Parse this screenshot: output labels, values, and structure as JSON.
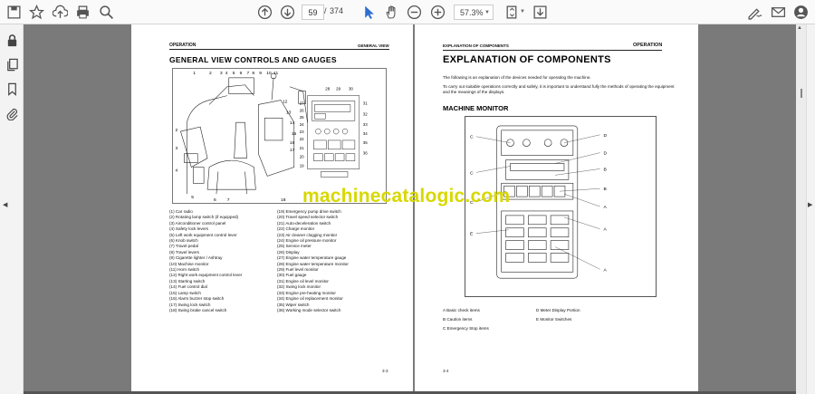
{
  "toolbar": {
    "page_current": "59",
    "page_separator": "/",
    "page_total": "374",
    "zoom_value": "57.3%",
    "icons": [
      "save-icon",
      "bookmark-star-icon",
      "upload-icon",
      "print-icon",
      "zoom-search-icon",
      "page-up-icon",
      "page-down-icon",
      "select-cursor-icon",
      "hand-icon",
      "zoom-out-icon",
      "zoom-in-icon",
      "fit-page-icon",
      "export-icon",
      "sign-icon",
      "mail-icon",
      "account-icon"
    ]
  },
  "sidebar": {
    "icons": [
      "lock-icon",
      "copy-pages-icon",
      "bookmark-icon",
      "attachment-icon"
    ]
  },
  "left_page": {
    "header_left": "OPERATION",
    "header_right": "GENERAL VIEW",
    "title": "GENERAL VIEW CONTROLS AND GAUGES",
    "legend_col1": [
      "(1) Car radio",
      "(2) Rotating lamp switch (if equipped)",
      "(3) Airconditioner control panel",
      "(4) Safety lock levers",
      "(5) Left work equipment control lever",
      "(6) Knob switch",
      "(7) Travel pedal",
      "(8) Travel levers",
      "(9) Cigarette lighter / Ashtray",
      "(10) Machine monitor",
      "(11) Horn switch",
      "(12) Right work equipment control lever",
      "(13) Starting switch",
      "(14) Fuel control dial",
      "(15) Lamp switch",
      "(16) Alarm buzzer stop switch",
      "(17) Swing lock switch",
      "(18) Swing brake cancel switch"
    ],
    "legend_col2": [
      "(19) Emergency pump drive switch",
      "(20) Travel speed selector switch",
      "(21) Auto-deceleration switch",
      "(22) Charge monitor",
      "(23) Air cleaner clogging monitor",
      "(24) Engine oil pressure monitor",
      "(25) Service meter",
      "(26) Display",
      "(27) Engine water temperature gauge",
      "(28) Engine water temperature monitor",
      "(29) Fuel level monitor",
      "(30) Fuel gauge",
      "(31) Engine oil level monitor",
      "(32) Swing lock monitor",
      "(33) Engine pre-heating monitor",
      "(34) Engine oil replacement monitor",
      "(35) Wiper switch",
      "(36) Working mode selector switch"
    ],
    "page_number": "3-3"
  },
  "right_page": {
    "header_left": "EXPLANATION OF COMPONENTS",
    "header_right": "OPERATION",
    "title": "EXPLANATION OF COMPONENTS",
    "intro_1": "The following is an explanation of the devices needed for operating the machine.",
    "intro_2": "To carry out suitable operations correctly and safely, it is important to understand fully the methods of operating the equipment and the meanings of the displays.",
    "subtitle": "MACHINE MONITOR",
    "legend_left": [
      "A Basic check items",
      "B Caution items",
      "C Emergency Stop items"
    ],
    "legend_right": [
      "D Meter Display Portion",
      "E Monitor Switches"
    ],
    "page_number": "3-4"
  },
  "watermark": "machinecatalogic.com",
  "colors": {
    "viewer_bg": "#7a7a7a",
    "toolbar_bg": "#fafafa",
    "watermark": "#d8d800"
  }
}
